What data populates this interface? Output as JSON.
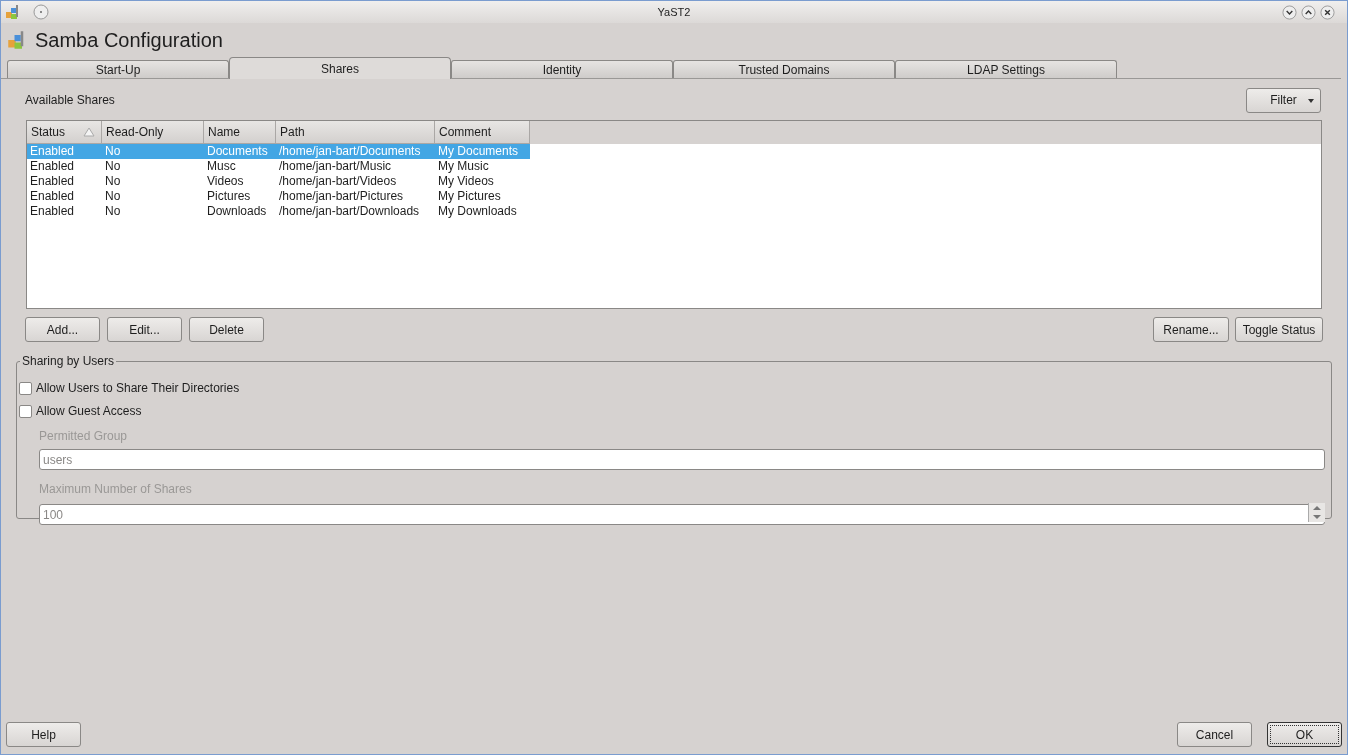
{
  "window": {
    "title": "YaST2"
  },
  "header": {
    "title": "Samba Configuration"
  },
  "tabs": [
    {
      "label": "Start-Up",
      "selected": false
    },
    {
      "label": "Shares",
      "selected": true
    },
    {
      "label": "Identity",
      "selected": false
    },
    {
      "label": "Trusted Domains",
      "selected": false
    },
    {
      "label": "LDAP Settings",
      "selected": false
    }
  ],
  "shares": {
    "label": "Available Shares",
    "filter_button": "Filter",
    "table": {
      "columns": [
        {
          "label": "Status",
          "sorted": true
        },
        {
          "label": "Read-Only",
          "sorted": false
        },
        {
          "label": "Name",
          "sorted": false
        },
        {
          "label": "Path",
          "sorted": false
        },
        {
          "label": "Comment",
          "sorted": false
        }
      ],
      "rows": [
        {
          "cells": [
            "Enabled",
            "No",
            "Documents",
            "/home/jan-bart/Documents",
            "My Documents"
          ],
          "selected": true
        },
        {
          "cells": [
            "Enabled",
            "No",
            "Musc",
            "/home/jan-bart/Music",
            "My Music"
          ],
          "selected": false
        },
        {
          "cells": [
            "Enabled",
            "No",
            "Videos",
            "/home/jan-bart/Videos",
            "My Videos"
          ],
          "selected": false
        },
        {
          "cells": [
            "Enabled",
            "No",
            "Pictures",
            "/home/jan-bart/Pictures",
            "My Pictures"
          ],
          "selected": false
        },
        {
          "cells": [
            "Enabled",
            "No",
            "Downloads",
            "/home/jan-bart/Downloads",
            "My Downloads"
          ],
          "selected": false
        }
      ]
    },
    "left_buttons": [
      "Add...",
      "Edit...",
      "Delete"
    ],
    "right_buttons": [
      "Rename...",
      "Toggle Status"
    ]
  },
  "sharing_by_users": {
    "title": "Sharing by Users",
    "checkboxes": [
      {
        "label": "Allow Users to Share Their Directories",
        "checked": false
      },
      {
        "label": "Allow Guest Access",
        "checked": false
      }
    ],
    "permitted_group": {
      "label": "Permitted Group",
      "value": "users",
      "disabled": true
    },
    "max_shares": {
      "label": "Maximum Number of Shares",
      "value": "100",
      "disabled": true
    }
  },
  "footer": {
    "help": "Help",
    "cancel": "Cancel",
    "ok": "OK"
  }
}
